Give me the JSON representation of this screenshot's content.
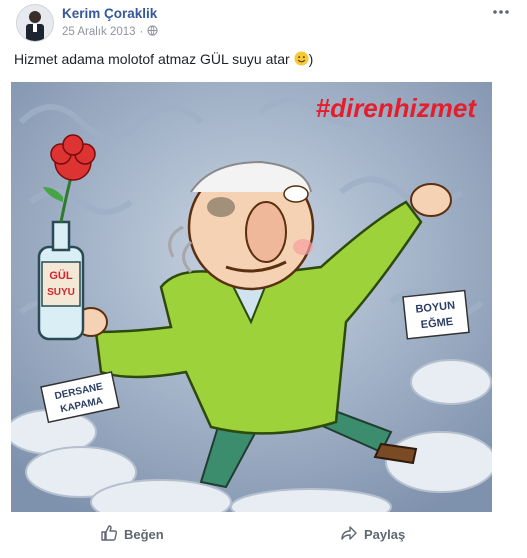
{
  "post": {
    "author": "Kerim Çoraklik",
    "date": "25 Aralık 2013",
    "date_separator": "·",
    "text": "Hizmet adama molotof atmaz GÜL suyu atar",
    "text_suffix": ")"
  },
  "image": {
    "hashtag": "#direnhizmet",
    "bottle_label_line1": "GÜL",
    "bottle_label_line2": "SUYU",
    "sign_left_line1": "DERSANE",
    "sign_left_line2": "KAPAMA",
    "sign_right_line1": "BOYUN",
    "sign_right_line2": "EĞME"
  },
  "actions": {
    "like_label": "Beğen",
    "share_label": "Paylaş"
  },
  "colors": {
    "author_link": "#365899",
    "hashtag": "#e41e2c",
    "action_text": "#606770",
    "coat": "#9dd23a"
  },
  "icons": [
    "globe-icon",
    "more-options-icon",
    "smile-emoji-icon",
    "like-thumb-icon",
    "share-arrow-icon"
  ]
}
